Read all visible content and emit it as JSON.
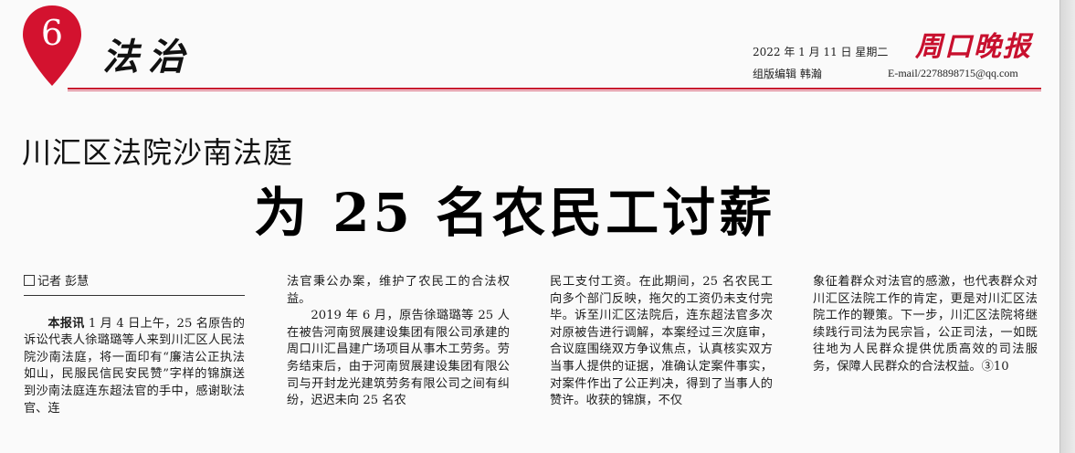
{
  "header": {
    "section_number": "6",
    "section_title": "法治",
    "date": "2022 年 1 月 11 日  星期二",
    "editor": "组版编辑  韩瀚",
    "newspaper_logo": "周口晚报",
    "email": "E-mail/2278898715@qq.com"
  },
  "article": {
    "kicker": "川汇区法院沙南法庭",
    "headline": "为 25 名农民工讨薪",
    "byline": "记者 彭慧",
    "lead_label": "本报讯",
    "col1_text": " 1 月 4 日上午，25 名原告的诉讼代表人徐璐璐等人来到川汇区人民法院沙南法庭，将一面印有“廉洁公正执法如山，民服民信民安民赞”字样的锦旗送到沙南法庭连东超法官的手中，感谢耿法官、连",
    "col2_p1": "法官秉公办案，维护了农民工的合法权益。",
    "col2_p2": "2019 年 6 月，原告徐璐璐等 25 人在被告河南贸展建设集团有限公司承建的周口川汇昌建广场项目从事木工劳务。劳务结束后，由于河南贸展建设集团有限公司与开封龙光建筑劳务有限公司之间有纠纷，迟迟未向 25 名农",
    "col3_text": "民工支付工资。在此期间，25 名农民工向多个部门反映，拖欠的工资仍未支付完毕。诉至川汇区法院后，连东超法官多次对原被告进行调解，本案经过三次庭审，合议庭围绕双方争议焦点，认真核实双方当事人提供的证据，准确认定案件事实，对案件作出了公正判决，得到了当事人的赞许。收获的锦旗，不仅",
    "col4_text": "象征着群众对法官的感激，也代表群众对川汇区法院工作的肯定，更是对川汇区法院工作的鞭策。下一步，川汇区法院将继续践行司法为民宗旨，公正司法，一如既往地为人民群众提供优质高效的司法服务，保障人民群众的合法权益。③10"
  },
  "colors": {
    "accent_red": "#c8102e"
  },
  "icons": {
    "section_badge": "red-map-pin-badge"
  }
}
